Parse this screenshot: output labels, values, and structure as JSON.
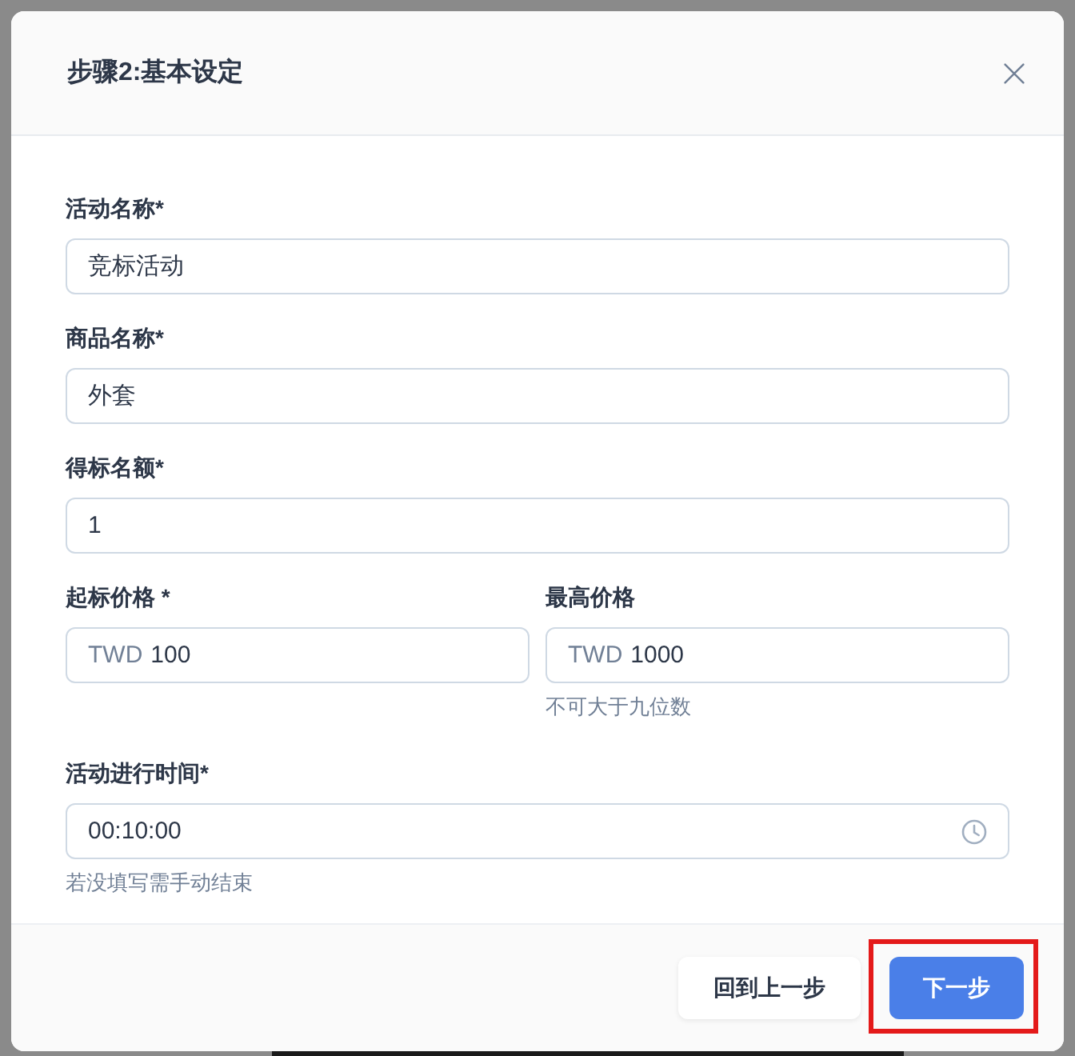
{
  "dialog": {
    "title": "步骤2:基本设定"
  },
  "form": [
    {
      "kind": "text",
      "label": "活动名称*",
      "value": "竞标活动"
    },
    {
      "kind": "text",
      "label": "商品名称*",
      "value": "外套"
    },
    {
      "kind": "text",
      "label": "得标名额*",
      "value": "1"
    },
    {
      "kind": "row",
      "fields": [
        {
          "kind": "text",
          "label": "起标价格 *",
          "prefix": "TWD",
          "value": "100"
        },
        {
          "kind": "text",
          "label": "最高价格",
          "prefix": "TWD",
          "value": "1000",
          "hint": "不可大于九位数"
        }
      ]
    },
    {
      "kind": "time",
      "label": "活动进行时间*",
      "value": "00:10:00",
      "hint": "若没填写需手动结束"
    }
  ],
  "buttons": [
    {
      "label": "回到上一步",
      "kind": "secondary"
    },
    {
      "label": "下一步",
      "kind": "primary",
      "highlighted": true
    }
  ]
}
